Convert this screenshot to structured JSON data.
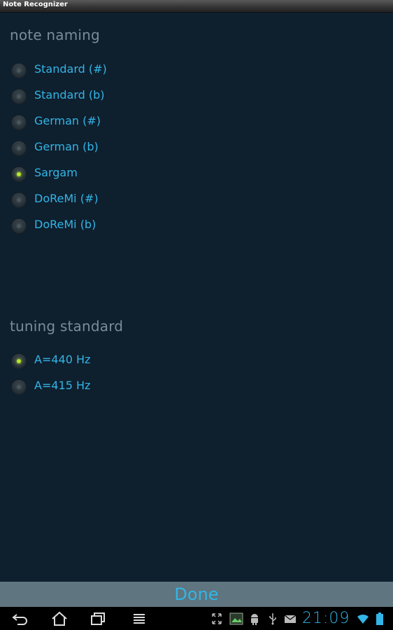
{
  "window": {
    "title": "Note Recognizer"
  },
  "note_naming": {
    "title": "note naming",
    "options": [
      {
        "label": "Standard (#)",
        "checked": false
      },
      {
        "label": "Standard (b)",
        "checked": false
      },
      {
        "label": "German (#)",
        "checked": false
      },
      {
        "label": "German (b)",
        "checked": false
      },
      {
        "label": "Sargam",
        "checked": true
      },
      {
        "label": "DoReMi (#)",
        "checked": false
      },
      {
        "label": "DoReMi (b)",
        "checked": false
      }
    ]
  },
  "tuning_standard": {
    "title": "tuning standard",
    "options": [
      {
        "label": "A=440 Hz",
        "checked": true
      },
      {
        "label": "A=415 Hz",
        "checked": false
      }
    ]
  },
  "footer": {
    "done_label": "Done"
  },
  "system_bar": {
    "time": "21:09",
    "nav_icons": [
      "back-icon",
      "home-icon",
      "recent-apps-icon",
      "menu-icon"
    ],
    "status_icons": [
      "screenshot-expand-icon",
      "gallery-icon",
      "android-debug-icon",
      "usb-icon",
      "email-icon",
      "wifi-icon",
      "battery-icon"
    ]
  },
  "colors": {
    "accent": "#33b5e5",
    "radio_checked": "#b6e62a",
    "background": "#0e1f2e",
    "done_bar": "#5f7580"
  }
}
